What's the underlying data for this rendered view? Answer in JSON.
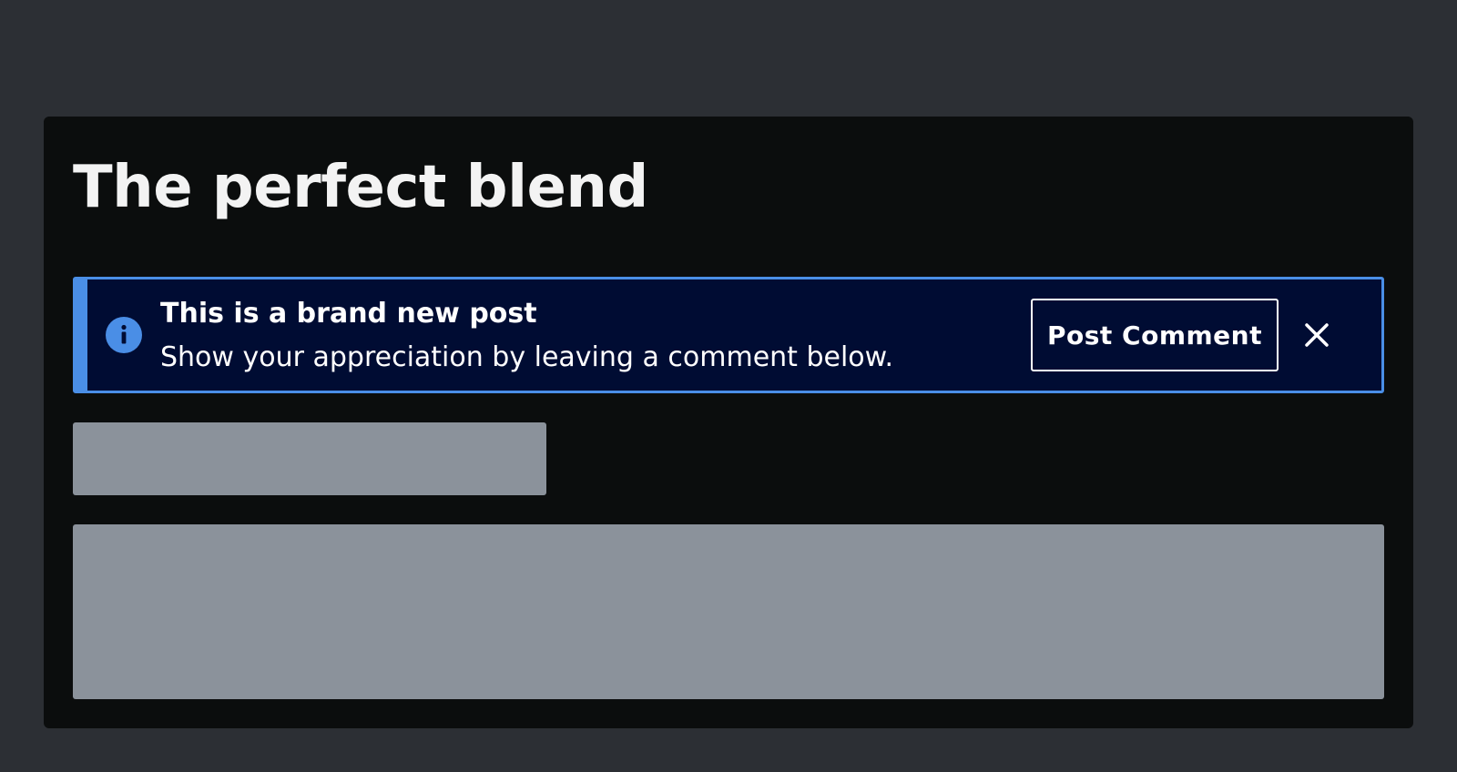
{
  "page": {
    "title": "The perfect blend"
  },
  "banner": {
    "icon": "info-icon",
    "title": "This is a brand new post",
    "message": "Show your appreciation by leaving a comment below.",
    "action_label": "Post Comment",
    "close_icon": "close-icon",
    "accent_color": "#4a8ee6",
    "background_color": "#000c33"
  },
  "colors": {
    "page_background": "#2c2f34",
    "card_background": "#0b0d0d",
    "skeleton": "#8b929b"
  }
}
